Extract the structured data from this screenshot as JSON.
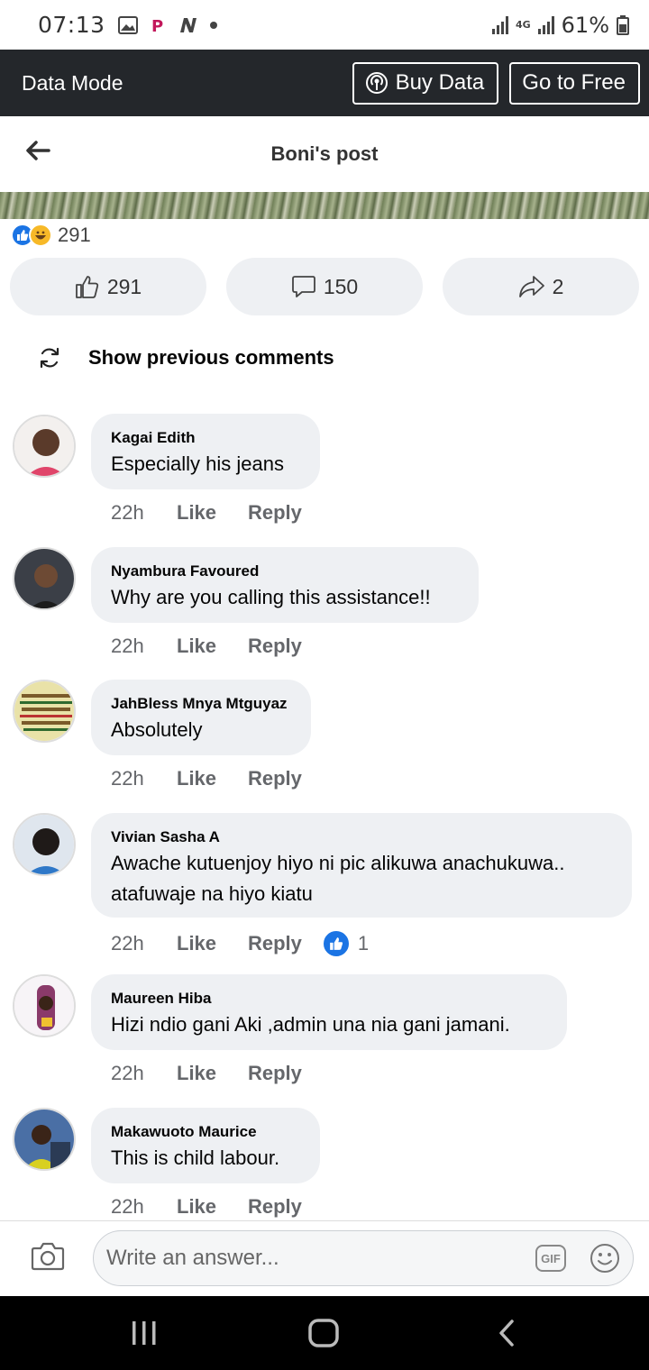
{
  "status_bar": {
    "time": "07:13",
    "network": "4G",
    "battery": "61%"
  },
  "data_mode": {
    "label": "Data Mode",
    "buy_data": "Buy Data",
    "go_free": "Go to Free"
  },
  "header": {
    "title": "Boni's post"
  },
  "reactions": {
    "total": "291"
  },
  "actions": {
    "likes": "291",
    "comments": "150",
    "shares": "2"
  },
  "show_previous": "Show previous comments",
  "comments": [
    {
      "name": "Kagai Edith",
      "text": "Especially his jeans",
      "time": "22h",
      "like": "Like",
      "reply": "Reply"
    },
    {
      "name": "Nyambura Favoured",
      "text": "Why are you calling this assistance!!",
      "time": "22h",
      "like": "Like",
      "reply": "Reply"
    },
    {
      "name": "JahBless Mnya Mtguyaz",
      "text": "Absolutely",
      "time": "22h",
      "like": "Like",
      "reply": "Reply"
    },
    {
      "name": "Vivian Sasha A",
      "text": "Awache kutuenjoy hiyo ni  pic alikuwa anachukuwa..",
      "text2": "atafuwaje na hiyo kiatu",
      "time": "22h",
      "like": "Like",
      "reply": "Reply",
      "reaction_count": "1"
    },
    {
      "name": "Maureen Hiba",
      "text": "Hizi ndio gani Aki ,admin una nia gani jamani.",
      "time": "22h",
      "like": "Like",
      "reply": "Reply"
    },
    {
      "name": "Makawuoto Maurice",
      "text": "This is child labour.",
      "time": "22h",
      "like": "Like",
      "reply": "Reply"
    }
  ],
  "composer": {
    "placeholder": "Write an answer...",
    "gif": "GIF"
  },
  "colors": {
    "facebook_blue": "#1b74e4",
    "data_bar": "#24272b",
    "bubble": "#eef0f3"
  }
}
